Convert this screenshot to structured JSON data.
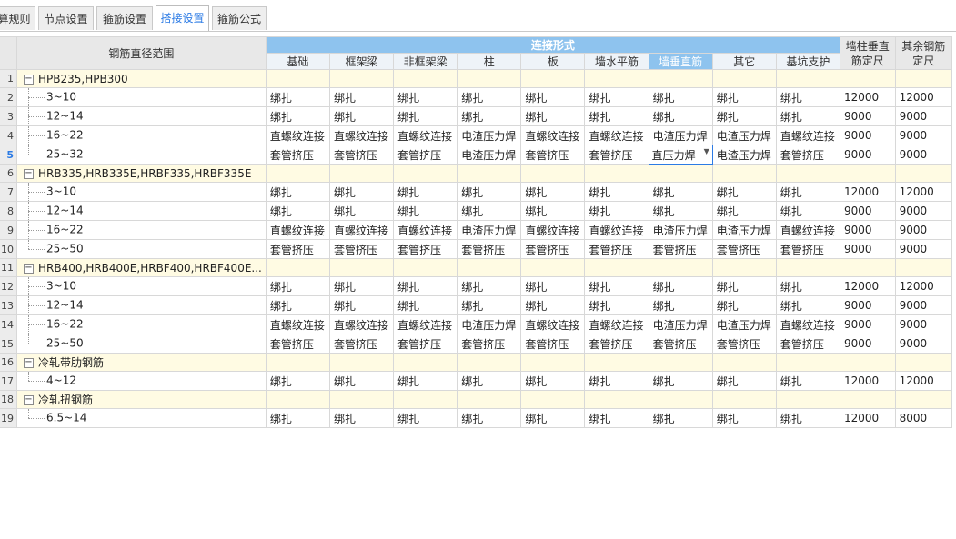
{
  "tabs": [
    {
      "label": "计算规则"
    },
    {
      "label": "节点设置"
    },
    {
      "label": "箍筋设置"
    },
    {
      "label": "搭接设置"
    },
    {
      "label": "箍筋公式"
    }
  ],
  "header": {
    "range_label": "钢筋直径范围",
    "connection_group": "连接形式",
    "columns": [
      "基础",
      "框架梁",
      "非框架梁",
      "柱",
      "板",
      "墙水平筋",
      "墙垂直筋",
      "其它",
      "基坑支护"
    ],
    "wall_col_label": "墙柱垂直筋定尺",
    "other_label": "其余钢筋定尺"
  },
  "rows": [
    {
      "num": "1",
      "type": "cat",
      "label": "HPB235,HPB300"
    },
    {
      "num": "2",
      "type": "data",
      "label": "3~10",
      "cells": [
        "绑扎",
        "绑扎",
        "绑扎",
        "绑扎",
        "绑扎",
        "绑扎",
        "绑扎",
        "绑扎",
        "绑扎"
      ],
      "wall": "12000",
      "other": "12000"
    },
    {
      "num": "3",
      "type": "data",
      "label": "12~14",
      "cells": [
        "绑扎",
        "绑扎",
        "绑扎",
        "绑扎",
        "绑扎",
        "绑扎",
        "绑扎",
        "绑扎",
        "绑扎"
      ],
      "wall": "9000",
      "other": "9000"
    },
    {
      "num": "4",
      "type": "data",
      "label": "16~22",
      "cells": [
        "直螺纹连接",
        "直螺纹连接",
        "直螺纹连接",
        "电渣压力焊",
        "直螺纹连接",
        "直螺纹连接",
        "电渣压力焊",
        "电渣压力焊",
        "直螺纹连接"
      ],
      "wall": "9000",
      "other": "9000"
    },
    {
      "num": "5",
      "type": "data",
      "label": "25~32",
      "cells": [
        "套管挤压",
        "套管挤压",
        "套管挤压",
        "电渣压力焊",
        "套管挤压",
        "套管挤压",
        "直压力焊",
        "电渣压力焊",
        "套管挤压"
      ],
      "wall": "9000",
      "other": "9000"
    },
    {
      "num": "6",
      "type": "cat",
      "label": "HRB335,HRB335E,HRBF335,HRBF335E"
    },
    {
      "num": "7",
      "type": "data",
      "label": "3~10",
      "cells": [
        "绑扎",
        "绑扎",
        "绑扎",
        "绑扎",
        "绑扎",
        "绑扎",
        "绑扎",
        "绑扎",
        "绑扎"
      ],
      "wall": "12000",
      "other": "12000"
    },
    {
      "num": "8",
      "type": "data",
      "label": "12~14",
      "cells": [
        "绑扎",
        "绑扎",
        "绑扎",
        "绑扎",
        "绑扎",
        "绑扎",
        "绑扎",
        "绑扎",
        "绑扎"
      ],
      "wall": "9000",
      "other": "9000"
    },
    {
      "num": "9",
      "type": "data",
      "label": "16~22",
      "cells": [
        "直螺纹连接",
        "直螺纹连接",
        "直螺纹连接",
        "电渣压力焊",
        "直螺纹连接",
        "直螺纹连接",
        "电渣压力焊",
        "电渣压力焊",
        "直螺纹连接"
      ],
      "wall": "9000",
      "other": "9000"
    },
    {
      "num": "10",
      "type": "data",
      "label": "25~50",
      "cells": [
        "套管挤压",
        "套管挤压",
        "套管挤压",
        "套管挤压",
        "套管挤压",
        "套管挤压",
        "套管挤压",
        "套管挤压",
        "套管挤压"
      ],
      "wall": "9000",
      "other": "9000"
    },
    {
      "num": "11",
      "type": "cat",
      "label": "HRB400,HRB400E,HRBF400,HRBF400E..."
    },
    {
      "num": "12",
      "type": "data",
      "label": "3~10",
      "cells": [
        "绑扎",
        "绑扎",
        "绑扎",
        "绑扎",
        "绑扎",
        "绑扎",
        "绑扎",
        "绑扎",
        "绑扎"
      ],
      "wall": "12000",
      "other": "12000"
    },
    {
      "num": "13",
      "type": "data",
      "label": "12~14",
      "cells": [
        "绑扎",
        "绑扎",
        "绑扎",
        "绑扎",
        "绑扎",
        "绑扎",
        "绑扎",
        "绑扎",
        "绑扎"
      ],
      "wall": "9000",
      "other": "9000"
    },
    {
      "num": "14",
      "type": "data",
      "label": "16~22",
      "cells": [
        "直螺纹连接",
        "直螺纹连接",
        "直螺纹连接",
        "电渣压力焊",
        "直螺纹连接",
        "直螺纹连接",
        "电渣压力焊",
        "电渣压力焊",
        "直螺纹连接"
      ],
      "wall": "9000",
      "other": "9000"
    },
    {
      "num": "15",
      "type": "data",
      "label": "25~50",
      "cells": [
        "套管挤压",
        "套管挤压",
        "套管挤压",
        "套管挤压",
        "套管挤压",
        "套管挤压",
        "套管挤压",
        "套管挤压",
        "套管挤压"
      ],
      "wall": "9000",
      "other": "9000"
    },
    {
      "num": "16",
      "type": "cat",
      "label": "冷轧带肋钢筋"
    },
    {
      "num": "17",
      "type": "data",
      "label": "4~12",
      "cells": [
        "绑扎",
        "绑扎",
        "绑扎",
        "绑扎",
        "绑扎",
        "绑扎",
        "绑扎",
        "绑扎",
        "绑扎"
      ],
      "wall": "12000",
      "other": "12000"
    },
    {
      "num": "18",
      "type": "cat",
      "label": "冷轧扭钢筋"
    },
    {
      "num": "19",
      "type": "data",
      "label": "6.5~14",
      "cells": [
        "绑扎",
        "绑扎",
        "绑扎",
        "绑扎",
        "绑扎",
        "绑扎",
        "绑扎",
        "绑扎",
        "绑扎"
      ],
      "wall": "12000",
      "other": "8000"
    }
  ],
  "selection": {
    "row_num": "5",
    "column_index": 6
  }
}
